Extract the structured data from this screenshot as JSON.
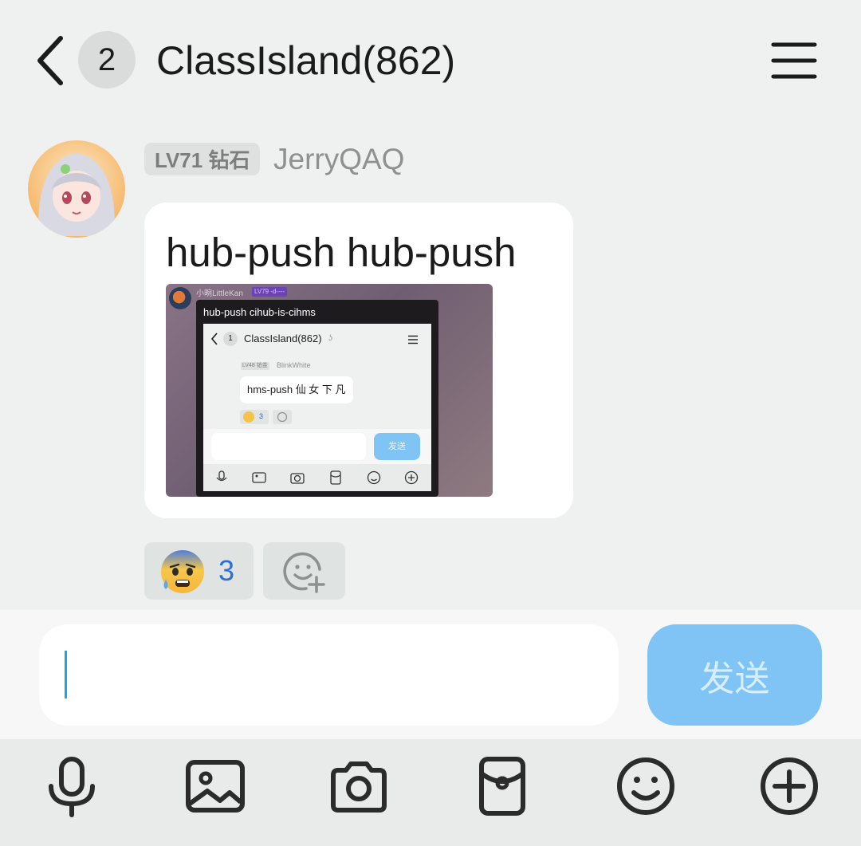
{
  "header": {
    "back_icon": "chevron-left-icon",
    "unread_count": "2",
    "title": "ClassIsland(862)",
    "menu_icon": "hamburger-menu-icon"
  },
  "message": {
    "avatar": "anime-avatar",
    "level_badge": "LV71 钻石",
    "sender": "JerryQAQ",
    "text": "hub-push hub-push",
    "image": {
      "sender": "小畹LittleKan",
      "level_badge": "LV79 -d----",
      "card_text": "hub-push cihub-is-cihms",
      "screen": {
        "unread_count": "1",
        "title": "ClassIsland(862)",
        "msg_level": "LV48 铂金",
        "msg_sender": "BlinkWhite",
        "msg_text": "hms-push 仙 女 下 凡",
        "reaction_count": "3",
        "send_label": "发送"
      }
    }
  },
  "reactions": {
    "emoji": "anxious-face-with-sweat",
    "count": "3",
    "add_icon": "add-reaction-icon"
  },
  "input": {
    "value": "",
    "send_label": "发送"
  },
  "toolbar": {
    "icons": [
      "microphone-icon",
      "image-icon",
      "camera-icon",
      "red-packet-icon",
      "emoji-icon",
      "plus-icon"
    ]
  },
  "colors": {
    "background": "#eef1ef",
    "send_button": "#7fc4f5",
    "reaction_count": "#2a6fd6",
    "caret": "#17a6e6"
  }
}
